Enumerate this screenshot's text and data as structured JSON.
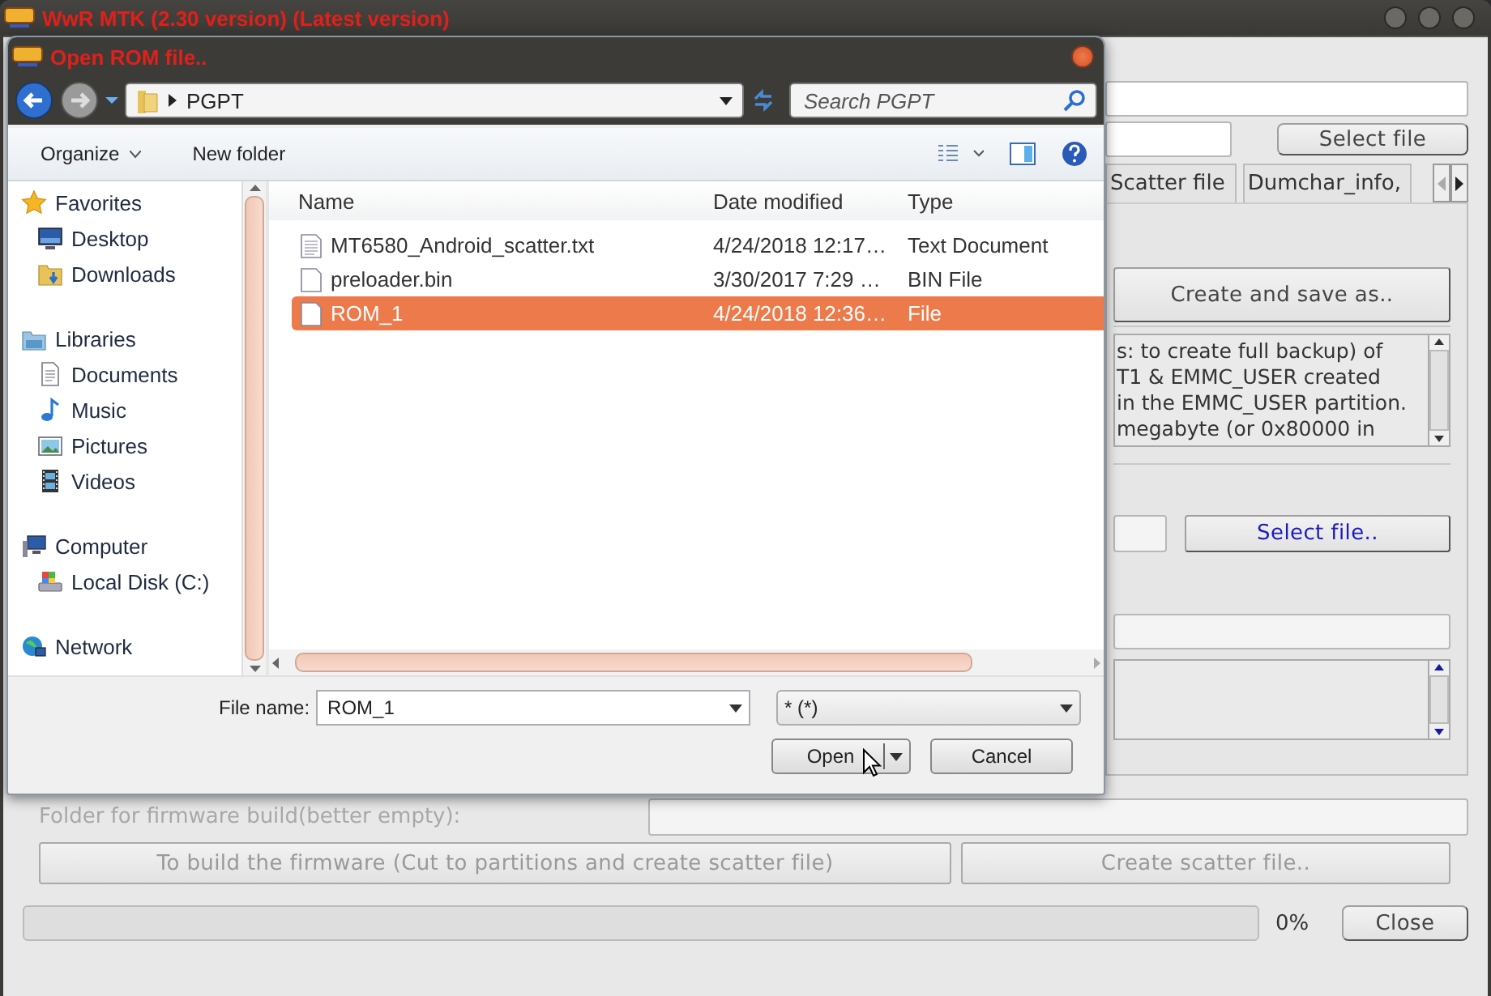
{
  "main_window": {
    "title": "WwR MTK (2.30 version) (Latest version)",
    "select_file_button": "Select file",
    "tabs": [
      {
        "label": "Scatter file",
        "selected": false
      },
      {
        "label": "Dumchar_info,",
        "selected": false
      }
    ],
    "create_button": "Create and save as..",
    "info_lines": [
      "s: to create full backup) of",
      "T1 & EMMC_USER created",
      "in the EMMC_USER partition.",
      "megabyte (or 0x80000 in"
    ],
    "select_file_button_2": "Select file..",
    "firmware_folder": {
      "label": "Folder for firmware build(better empty):",
      "disabled": true
    },
    "build_button": {
      "label": "To build the firmware (Cut to partitions and create scatter file)",
      "disabled": true
    },
    "scatter_button": {
      "label": "Create scatter file..",
      "disabled": true
    },
    "progress": {
      "level": 0,
      "reading": "0%"
    },
    "close_button": "Close"
  },
  "dialog": {
    "title": "Open ROM file..",
    "address": "PGPT",
    "search": {
      "placeholder": "Search PGPT"
    },
    "toolbar": [
      "Organize",
      "New folder"
    ],
    "sidebar": [
      {
        "label": "Favorites",
        "kind": "star",
        "children": [
          {
            "label": "Desktop",
            "kind": "desktop"
          },
          {
            "label": "Downloads",
            "kind": "downloads"
          }
        ]
      },
      {
        "label": "Libraries",
        "kind": "libraries",
        "children": [
          {
            "label": "Documents",
            "kind": "documents"
          },
          {
            "label": "Music",
            "kind": "music"
          },
          {
            "label": "Pictures",
            "kind": "pictures"
          },
          {
            "label": "Videos",
            "kind": "videos"
          }
        ]
      },
      {
        "label": "Computer",
        "kind": "computer",
        "children": [
          {
            "label": "Local Disk (C:)",
            "kind": "disk"
          }
        ]
      },
      {
        "label": "Network",
        "kind": "network"
      }
    ],
    "columns": [
      "Name",
      "Date modified",
      "Type"
    ],
    "files": [
      {
        "name": "MT6580_Android_scatter.txt",
        "date": "4/24/2018 12:17…",
        "type": "Text Document",
        "kind": "text",
        "selected": false
      },
      {
        "name": "preloader.bin",
        "date": "3/30/2017 7:29 …",
        "type": "BIN File",
        "kind": "blank",
        "selected": false
      },
      {
        "name": "ROM_1",
        "date": "4/24/2018 12:36…",
        "type": "File",
        "kind": "blank",
        "selected": true
      }
    ],
    "file_name": {
      "label": "File name:",
      "value": "ROM_1"
    },
    "filter": "* (*)",
    "open_button": "Open",
    "cancel_button": "Cancel"
  }
}
